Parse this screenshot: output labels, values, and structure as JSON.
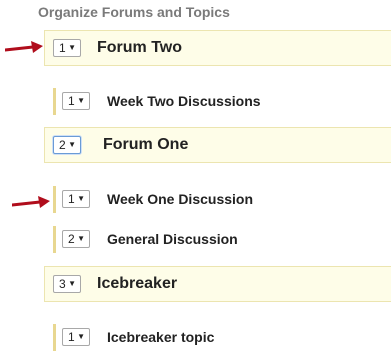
{
  "heading": "Organize Forums and Topics",
  "caret_glyph": "▼",
  "accent_color": "#b00d1c",
  "forums": [
    {
      "order": "1",
      "title": "Forum Two",
      "topics": [
        {
          "order": "1",
          "title": "Week Two Discussions"
        }
      ]
    },
    {
      "order": "2",
      "title": "Forum One",
      "topics": [
        {
          "order": "1",
          "title": "Week One Discussion"
        },
        {
          "order": "2",
          "title": "General Discussion"
        }
      ]
    },
    {
      "order": "3",
      "title": "Icebreaker",
      "topics": [
        {
          "order": "1",
          "title": "Icebreaker topic"
        }
      ]
    }
  ]
}
